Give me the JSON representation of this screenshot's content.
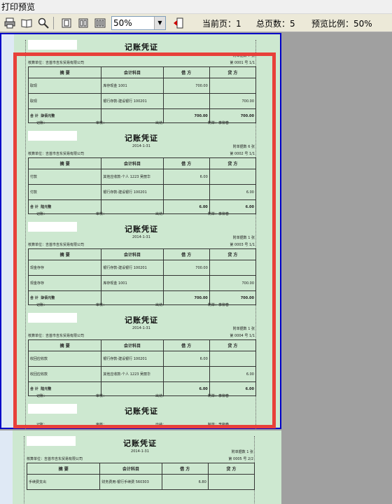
{
  "window": {
    "title": "打印预览"
  },
  "toolbar": {
    "zoom_value": "50%",
    "current_page_label": "当前页：1",
    "total_pages_label": "总页数：5",
    "preview_ratio_label": "预览比例：50%"
  },
  "columns": {
    "summary": "摘  要",
    "account": "会计科目",
    "debit": "借  方",
    "credit": "贷  方"
  },
  "labels": {
    "title": "记账凭证",
    "date": "2014-1-31",
    "unit": "核算单位：吉首市吉东贸易有限公司",
    "attach": "附单据数",
    "attach_unit": "张",
    "seq_prefix": "第",
    "seq_suffix": "号",
    "total": "合  计",
    "footer_left": "记账：",
    "footer_mid": "审核：",
    "footer_right": "出纳：",
    "footer_make": "制单：李柳春"
  },
  "vouchers": [
    {
      "attach": "7",
      "seq": "0001",
      "page": "1/1",
      "rows": [
        {
          "summary": "取现",
          "account": "库存现金  1001",
          "debit": "700.00",
          "credit": ""
        },
        {
          "summary": "取现",
          "account": "银行存款-建设银行  100201",
          "debit": "",
          "credit": "700.00"
        }
      ],
      "total_words": "柒佰元整",
      "total_debit": "700.00",
      "total_credit": "700.00"
    },
    {
      "attach": "6",
      "seq": "0002",
      "page": "1/1",
      "rows": [
        {
          "summary": "付款",
          "account": "其他应收款-个人  1223  吴丽华",
          "debit": "6.00",
          "credit": ""
        },
        {
          "summary": "付款",
          "account": "银行存款-建设银行  100201",
          "debit": "",
          "credit": "6.00"
        }
      ],
      "total_words": "陆元整",
      "total_debit": "6.00",
      "total_credit": "6.00"
    },
    {
      "attach": "1",
      "seq": "0003",
      "page": "1/1",
      "rows": [
        {
          "summary": "现金存存",
          "account": "银行存款-建设银行  100201",
          "debit": "700.00",
          "credit": ""
        },
        {
          "summary": "现金存存",
          "account": "库存现金  1001",
          "debit": "",
          "credit": "700.00"
        }
      ],
      "total_words": "柒佰元整",
      "total_debit": "700.00",
      "total_credit": "700.00"
    },
    {
      "attach": "1",
      "seq": "0004",
      "page": "1/1",
      "rows": [
        {
          "summary": "收回应收款",
          "account": "银行存款-建设银行  100201",
          "debit": "6.00",
          "credit": ""
        },
        {
          "summary": "收回应收款",
          "account": "其他应收款-个人  1223  吴丽华",
          "debit": "",
          "credit": "6.00"
        }
      ],
      "total_words": "陆元整",
      "total_debit": "6.00",
      "total_credit": "6.00"
    },
    {
      "attach": "1",
      "seq": "0005",
      "page": "2/2",
      "rows": [
        {
          "summary": "手续费支出",
          "account": "财务费用-银行手续费  560303",
          "debit": "6.80",
          "credit": ""
        }
      ]
    }
  ]
}
